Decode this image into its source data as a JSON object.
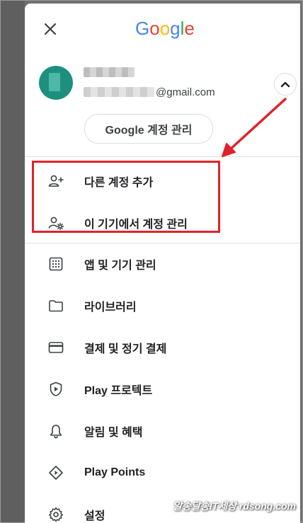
{
  "logo": {
    "letters": [
      "G",
      "o",
      "o",
      "g",
      "l",
      "e"
    ],
    "colors": [
      "#4285F4",
      "#EA4335",
      "#FBBC05",
      "#4285F4",
      "#34A853",
      "#EA4335"
    ]
  },
  "account": {
    "email_suffix": "@gmail.com",
    "manage_label": "Google 계정 관리"
  },
  "account_menu": [
    {
      "label": "다른 계정 추가",
      "icon": "person-add-icon"
    },
    {
      "label": "이 기기에서 계정 관리",
      "icon": "manage-accounts-icon"
    }
  ],
  "menu": [
    {
      "label": "앱 및 기기 관리",
      "icon": "apps-grid-icon"
    },
    {
      "label": "라이브러리",
      "icon": "folder-icon"
    },
    {
      "label": "결제 및 정기 결제",
      "icon": "credit-card-icon"
    },
    {
      "label": "Play 프로텍트",
      "icon": "shield-play-icon"
    },
    {
      "label": "알림 및 혜택",
      "icon": "bell-icon"
    },
    {
      "label": "Play Points",
      "icon": "diamond-icon"
    },
    {
      "label": "설정",
      "icon": "gear-icon"
    }
  ],
  "annotation": {
    "highlight_color": "#e0222a"
  },
  "watermark": "알송달송IT세상 rdsong.com"
}
